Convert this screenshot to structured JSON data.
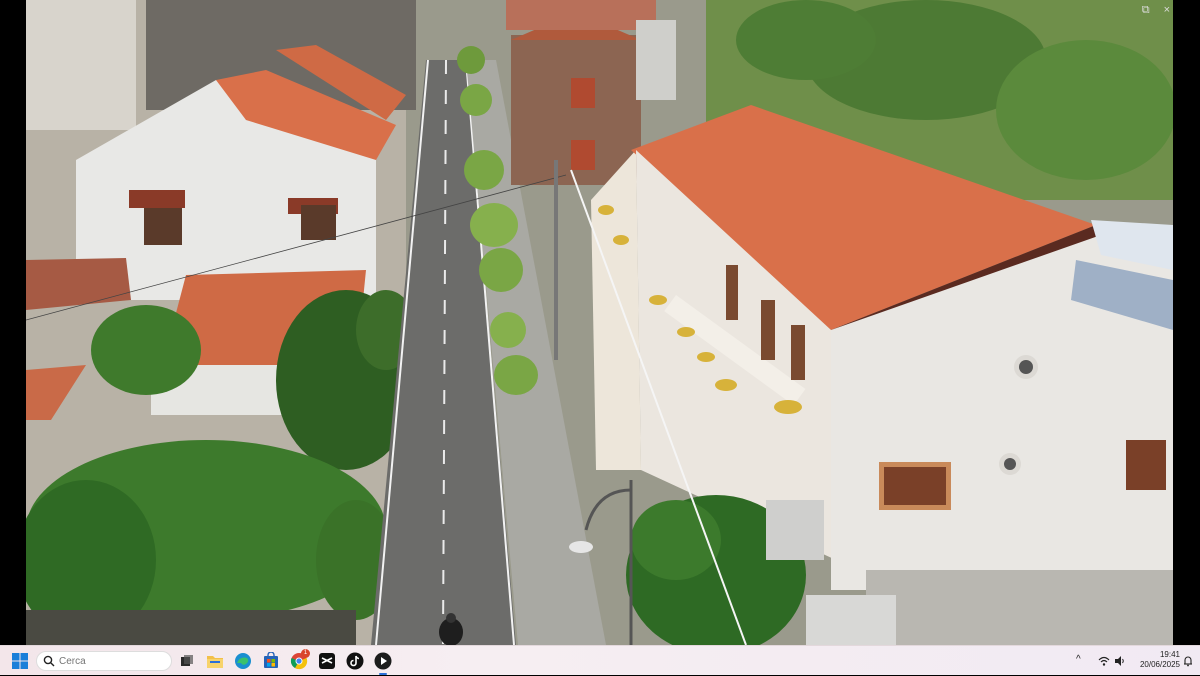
{
  "player": {
    "top_controls": {
      "pip_glyph": "⧉",
      "close_glyph": "×"
    }
  },
  "taskbar": {
    "search": {
      "placeholder": "Cerca",
      "value": ""
    },
    "pinned_apps": [
      {
        "name": "task-view",
        "icon": "task-view-icon"
      },
      {
        "name": "file-explorer",
        "icon": "folder-icon"
      },
      {
        "name": "edge",
        "icon": "edge-icon"
      },
      {
        "name": "store",
        "icon": "store-icon"
      },
      {
        "name": "chrome",
        "icon": "chrome-icon",
        "badge": "1"
      },
      {
        "name": "capcut",
        "icon": "capcut-icon"
      },
      {
        "name": "tiktok",
        "icon": "tiktok-icon"
      },
      {
        "name": "media-player",
        "icon": "media-player-icon",
        "active": true
      }
    ],
    "tray": {
      "chevron_glyph": "^",
      "time": "19:41",
      "date": "20/06/2025"
    }
  },
  "colors": {
    "taskbar_bg": "#f3e6ea",
    "accent": "#2b6fd8",
    "roof": "#d9704a",
    "foliage": "#3d7a2c"
  }
}
